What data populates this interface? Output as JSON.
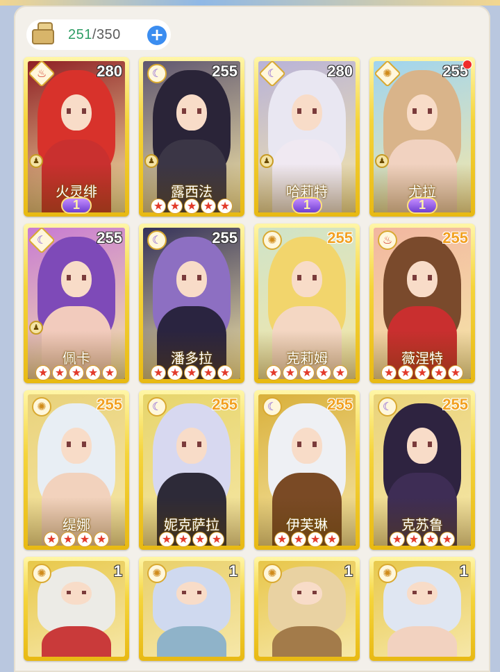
{
  "resource": {
    "icon": "supply-box-icon",
    "current": "251",
    "separator": "/",
    "max": "350",
    "add_label": "+"
  },
  "cards": [
    {
      "name": "火灵绯",
      "level": "280",
      "element": "fire",
      "frame": "diamond",
      "level_style": "white",
      "rank": "1",
      "stars": 0,
      "pawn": true,
      "notify": false,
      "art": {
        "hair": "#d8322b",
        "bg": "#8f1f24",
        "body": "#c9302f"
      }
    },
    {
      "name": "露西法",
      "level": "255",
      "element": "moon",
      "frame": "circle",
      "level_style": "white",
      "rank": "",
      "stars": 5,
      "pawn": true,
      "notify": false,
      "art": {
        "hair": "#2a2438",
        "bg": "#5f5670",
        "body": "#3b3646"
      }
    },
    {
      "name": "哈莉特",
      "level": "280",
      "element": "moon",
      "frame": "diamond",
      "level_style": "white",
      "rank": "1",
      "stars": 0,
      "pawn": true,
      "notify": false,
      "art": {
        "hair": "#e9e7f2",
        "bg": "#b8b2d8",
        "body": "#f0e9f2"
      }
    },
    {
      "name": "尤拉",
      "level": "255",
      "element": "sun",
      "frame": "diamond",
      "level_style": "white",
      "rank": "1",
      "stars": 0,
      "pawn": true,
      "notify": true,
      "art": {
        "hair": "#d9b48a",
        "bg": "#9fd4ef",
        "body": "#f1d2c0"
      }
    },
    {
      "name": "佩卡",
      "level": "255",
      "element": "moon",
      "frame": "diamond",
      "level_style": "white",
      "rank": "",
      "stars": 5,
      "pawn": true,
      "notify": false,
      "art": {
        "hair": "#7e4ab8",
        "bg": "#c77ad3",
        "body": "#f2cbbd"
      }
    },
    {
      "name": "潘多拉",
      "level": "255",
      "element": "moon",
      "frame": "circle",
      "level_style": "white",
      "rank": "",
      "stars": 5,
      "pawn": false,
      "notify": false,
      "art": {
        "hair": "#8d6fc2",
        "bg": "#34315a",
        "body": "#2a2440"
      }
    },
    {
      "name": "克莉姆",
      "level": "255",
      "element": "sun",
      "frame": "circle",
      "level_style": "orange",
      "rank": "",
      "stars": 5,
      "pawn": false,
      "notify": false,
      "art": {
        "hair": "#f2d56c",
        "bg": "#cfe3c8",
        "body": "#f4d7c3"
      }
    },
    {
      "name": "薇涅特",
      "level": "255",
      "element": "fire",
      "frame": "circle",
      "level_style": "orange",
      "rank": "",
      "stars": 5,
      "pawn": false,
      "notify": false,
      "art": {
        "hair": "#7a4a2c",
        "bg": "#f2b6a0",
        "body": "#c92f2f"
      }
    },
    {
      "name": "缇娜",
      "level": "255",
      "element": "sun",
      "frame": "circle",
      "level_style": "orange",
      "rank": "",
      "stars": 4,
      "pawn": false,
      "notify": false,
      "art": {
        "hair": "#e8eef4",
        "bg": "#e9d27b",
        "body": "#f2d2bd"
      }
    },
    {
      "name": "妮克萨拉",
      "level": "255",
      "element": "moon",
      "frame": "circle",
      "level_style": "orange",
      "rank": "",
      "stars": 4,
      "pawn": false,
      "notify": false,
      "art": {
        "hair": "#d7d8f0",
        "bg": "#e7d56b",
        "body": "#2d2a38"
      }
    },
    {
      "name": "伊芙琳",
      "level": "255",
      "element": "moon",
      "frame": "circle",
      "level_style": "orange",
      "rank": "",
      "stars": 4,
      "pawn": false,
      "notify": false,
      "art": {
        "hair": "#eef0f4",
        "bg": "#d9b03b",
        "body": "#7a4a25"
      }
    },
    {
      "name": "克苏鲁",
      "level": "255",
      "element": "moon",
      "frame": "circle",
      "level_style": "orange",
      "rank": "",
      "stars": 4,
      "pawn": false,
      "notify": false,
      "art": {
        "hair": "#2e2340",
        "bg": "#ead37a",
        "body": "#3e2d55"
      }
    },
    {
      "name": "",
      "level": "1",
      "element": "sun",
      "frame": "circle",
      "level_style": "white",
      "rank": "",
      "stars": 0,
      "pawn": false,
      "notify": false,
      "partial": true,
      "art": {
        "hair": "#ecebe6",
        "bg": "#e8c84a",
        "body": "#c93a3a"
      }
    },
    {
      "name": "",
      "level": "1",
      "element": "sun",
      "frame": "circle",
      "level_style": "white",
      "rank": "",
      "stars": 0,
      "pawn": false,
      "notify": false,
      "partial": true,
      "art": {
        "hair": "#cfd9ef",
        "bg": "#e9d06a",
        "body": "#8fb3c9"
      }
    },
    {
      "name": "",
      "level": "1",
      "element": "sun",
      "frame": "circle",
      "level_style": "white",
      "rank": "",
      "stars": 0,
      "pawn": false,
      "notify": false,
      "partial": true,
      "art": {
        "hair": "#e9d2a2",
        "bg": "#e8c64a",
        "body": "#a37b4a"
      }
    },
    {
      "name": "",
      "level": "1",
      "element": "sun",
      "frame": "circle",
      "level_style": "white",
      "rank": "",
      "stars": 0,
      "pawn": false,
      "notify": false,
      "partial": true,
      "art": {
        "hair": "#dfe6f2",
        "bg": "#e8c94d",
        "body": "#f2d2c0"
      }
    }
  ]
}
